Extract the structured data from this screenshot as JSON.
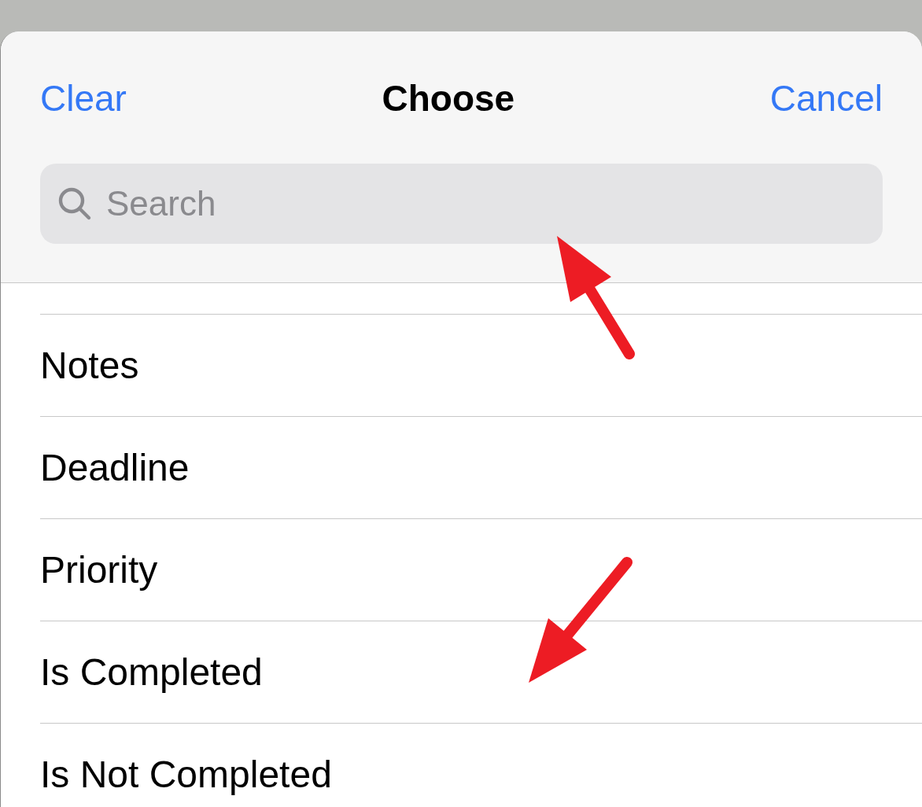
{
  "header": {
    "left_action": "Clear",
    "title": "Choose",
    "right_action": "Cancel"
  },
  "search": {
    "placeholder": "Search"
  },
  "items": [
    {
      "label": "Notes"
    },
    {
      "label": "Deadline"
    },
    {
      "label": "Priority"
    },
    {
      "label": "Is Completed"
    },
    {
      "label": "Is Not Completed"
    }
  ]
}
